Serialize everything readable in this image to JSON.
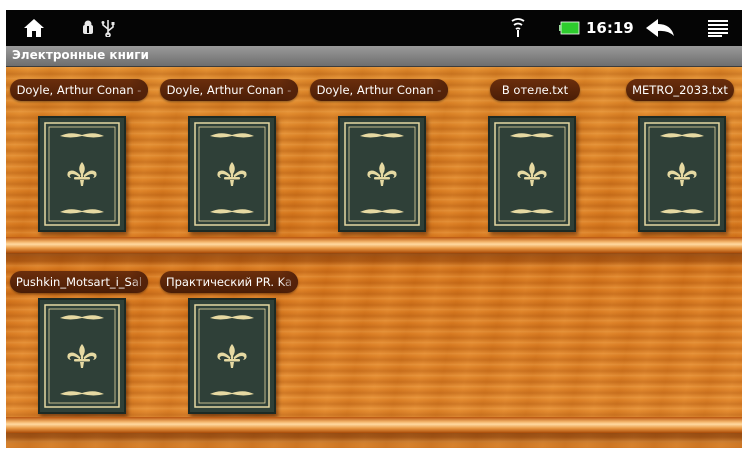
{
  "status_bar": {
    "time": "16:19",
    "icons": [
      "home-icon",
      "android-debug-icon",
      "usb-icon",
      "wifi-icon",
      "battery-icon",
      "back-icon",
      "menu-icon"
    ],
    "battery_color": "#2ecc2e"
  },
  "title_bar": {
    "title": "Электронные книги"
  },
  "shelves": [
    {
      "books": [
        {
          "label": "Doyle, Arthur Conan -"
        },
        {
          "label": "Doyle, Arthur Conan -"
        },
        {
          "label": "Doyle, Arthur Conan -"
        },
        {
          "label": "В отеле.txt"
        },
        {
          "label": "METRO_2033.txt"
        }
      ]
    },
    {
      "books": [
        {
          "label": "Pushkin_Motsart_i_Sal"
        },
        {
          "label": "Практический PR. Ka"
        }
      ]
    }
  ],
  "colors": {
    "wood": "#de7f22",
    "label_bg": "#5a250a",
    "book_cover": "#2f4038",
    "book_ornament": "#e6d9a2"
  }
}
